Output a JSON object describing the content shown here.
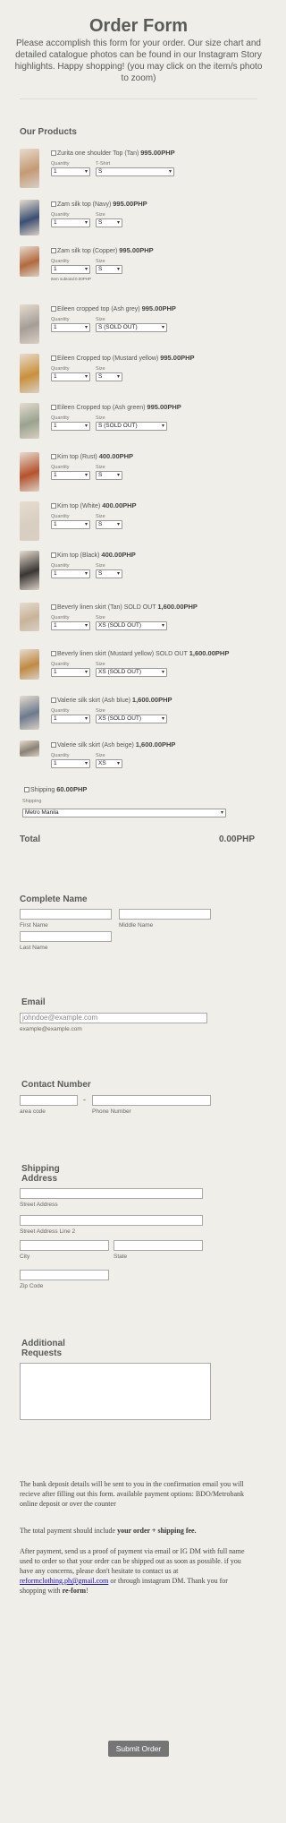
{
  "header": {
    "title": "Order Form",
    "intro": "Please accomplish this form for your order. Our size chart and detailed catalogue photos can be found in our Instagram Story highlights. Happy shopping! (you may click on the item/s photo to zoom)"
  },
  "products_heading": "Our Products",
  "quantity_label": "Quantity",
  "size_label": "Size",
  "tshirt_label": "T-Shirt",
  "products": [
    {
      "name": "Zurita one shoulder Top (Tan)",
      "price": "995.00PHP",
      "qty": "1",
      "size": "S",
      "color": "#c49a75"
    },
    {
      "name": "Zam silk top (Navy)",
      "price": "995.00PHP",
      "qty": "1",
      "size": "S",
      "color": "#3b4f73"
    },
    {
      "name": "Zam silk top (Copper)",
      "price": "995.00PHP",
      "qty": "1",
      "size": "S",
      "color": "#b26a3e",
      "note": "Item subtotal:0.00PHP"
    },
    {
      "name": "Eileen cropped top (Ash grey)",
      "price": "995.00PHP",
      "qty": "1",
      "size": "S (SOLD OUT)",
      "color": "#a59e98"
    },
    {
      "name": "Eileen Cropped top (Mustard yellow)",
      "price": "995.00PHP",
      "qty": "1",
      "size": "S",
      "color": "#c9913a"
    },
    {
      "name": "Eileen Cropped top (Ash green)",
      "price": "995.00PHP",
      "qty": "1",
      "size": "S (SOLD OUT)",
      "color": "#9aa38f"
    },
    {
      "name": "Kim top (Rust)",
      "price": "400.00PHP",
      "qty": "1",
      "size": "S",
      "color": "#b5532c"
    },
    {
      "name": "Kim top (White)",
      "price": "400.00PHP",
      "qty": "1",
      "size": "S",
      "color": "#d8cfc2"
    },
    {
      "name": "Kim top (Black)",
      "price": "400.00PHP",
      "qty": "1",
      "size": "S",
      "color": "#3a3634"
    },
    {
      "name": "Beverly linen skirt (Tan) SOLD OUT",
      "price": "1,600.00PHP",
      "qty": "1",
      "size": "XS (SOLD OUT)",
      "color": "#c8b39a"
    },
    {
      "name": "Beverly linen skirt (Mustard yellow) SOLD OUT",
      "price": "1,600.00PHP",
      "qty": "1",
      "size": "XS (SOLD OUT)",
      "color": "#c08a44"
    },
    {
      "name": "Valerie silk skirt (Ash blue)",
      "price": "1,600.00PHP",
      "qty": "1",
      "size": "XS (SOLD OUT)",
      "color": "#6d7a8e"
    },
    {
      "name": "Valerie silk skirt (Ash beige)",
      "price": "1,600.00PHP",
      "qty": "1",
      "size": "XS",
      "color": "#8a8276"
    }
  ],
  "shipping": {
    "label": "Shipping",
    "price": "60.00PHP",
    "select_label": "Shipping",
    "selected": "Metro Manila"
  },
  "total": {
    "label": "Total",
    "value": "0.00PHP"
  },
  "complete_name": {
    "heading": "Complete Name",
    "first": "First Name",
    "middle": "Middle Name",
    "last": "Last Name"
  },
  "email": {
    "heading": "Email",
    "placeholder": "johndoe@example.com",
    "hint": "example@example.com"
  },
  "contact": {
    "heading": "Contact Number",
    "dash": "-",
    "area": "area code",
    "phone": "Phone Number"
  },
  "address": {
    "heading": "Shipping Address",
    "street1": "Street Address",
    "street2": "Street Address Line 2",
    "city": "City",
    "state": "State",
    "zip": "Zip Code"
  },
  "requests": {
    "heading": "Additional Requests"
  },
  "footer": {
    "p1": "The bank deposit details will be sent to you in the confirmation email you will recieve after filling out this form. available payment options: BDO/Metrobank online deposit or over the counter",
    "p2_a": "The total payment should include ",
    "p2_b": "your order + shipping fee.",
    "p3_a": "After payment, send us a proof of payment via email or IG DM with full name used to order so that your order can be shipped out as soon as possible. if you have any concerns, please don't hesitate to contact us at ",
    "p3_link": "reformclothing.ph@gmail.com",
    "p3_b": " or through instagram DM. Thank you for shopping with ",
    "p3_brand": "re-form",
    "p3_end": "!"
  },
  "submit_label": "Submit Order"
}
